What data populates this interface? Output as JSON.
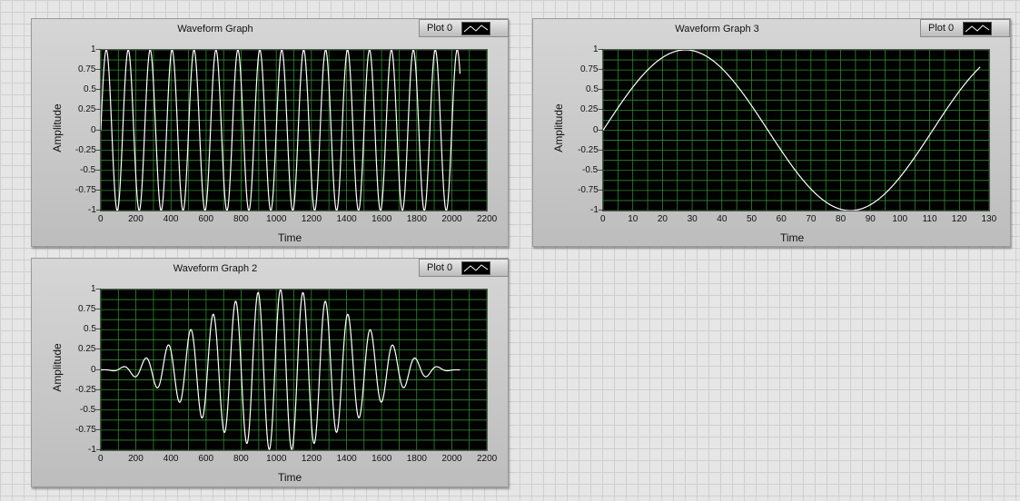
{
  "chart_data": [
    {
      "type": "line",
      "title": "Waveform Graph",
      "xlabel": "Time",
      "ylabel": "Amplitude",
      "xlim": [
        0,
        2200
      ],
      "ylim": [
        -1,
        1
      ],
      "x_ticks": [
        "0",
        "200",
        "400",
        "600",
        "800",
        "1000",
        "1200",
        "1400",
        "1600",
        "1800",
        "2000",
        "2200"
      ],
      "y_ticks": [
        "1",
        "0.75",
        "0.5",
        "0.25",
        "0",
        "-0.25",
        "-0.5",
        "-0.75",
        "-1"
      ],
      "grid": true,
      "legend_position": "top-right",
      "line_color": "#ffffff",
      "grid_color": "#2e8b2e",
      "background": "#000000",
      "series": [
        {
          "name": "Plot 0",
          "x_start": 0,
          "x_end": 2047,
          "shape": "sine",
          "amplitude": 1,
          "period": 125,
          "cycles": 16.4
        }
      ]
    },
    {
      "type": "line",
      "title": "Waveform Graph 3",
      "xlabel": "Time",
      "ylabel": "Amplitude",
      "xlim": [
        0,
        130
      ],
      "ylim": [
        -1,
        1
      ],
      "x_ticks": [
        "0",
        "10",
        "20",
        "30",
        "40",
        "50",
        "60",
        "70",
        "80",
        "90",
        "100",
        "110",
        "120",
        "130"
      ],
      "y_ticks": [
        "1",
        "0.75",
        "0.5",
        "0.25",
        "0",
        "-0.25",
        "-0.5",
        "-0.75",
        "-1"
      ],
      "grid": true,
      "legend_position": "top-right",
      "line_color": "#ffffff",
      "grid_color": "#2e8b2e",
      "background": "#000000",
      "series": [
        {
          "name": "Plot 0",
          "x_start": 0,
          "x_end": 127,
          "shape": "sine",
          "amplitude": 1,
          "period": 111
        }
      ]
    },
    {
      "type": "line",
      "title": "Waveform Graph 2",
      "xlabel": "Time",
      "ylabel": "Amplitude",
      "xlim": [
        0,
        2200
      ],
      "ylim": [
        -1,
        1
      ],
      "x_ticks": [
        "0",
        "200",
        "400",
        "600",
        "800",
        "1000",
        "1200",
        "1400",
        "1600",
        "1800",
        "2000",
        "2200"
      ],
      "y_ticks": [
        "1",
        "0.75",
        "0.5",
        "0.25",
        "0",
        "-0.25",
        "-0.5",
        "-0.75",
        "-1"
      ],
      "grid": true,
      "legend_position": "top-right",
      "line_color": "#ffffff",
      "grid_color": "#2e8b2e",
      "background": "#000000",
      "series": [
        {
          "name": "Plot 0",
          "x_start": 0,
          "x_end": 2047,
          "shape": "windowed-sine",
          "amplitude": 1,
          "period": 128,
          "envelope_center": 1024
        }
      ]
    }
  ]
}
